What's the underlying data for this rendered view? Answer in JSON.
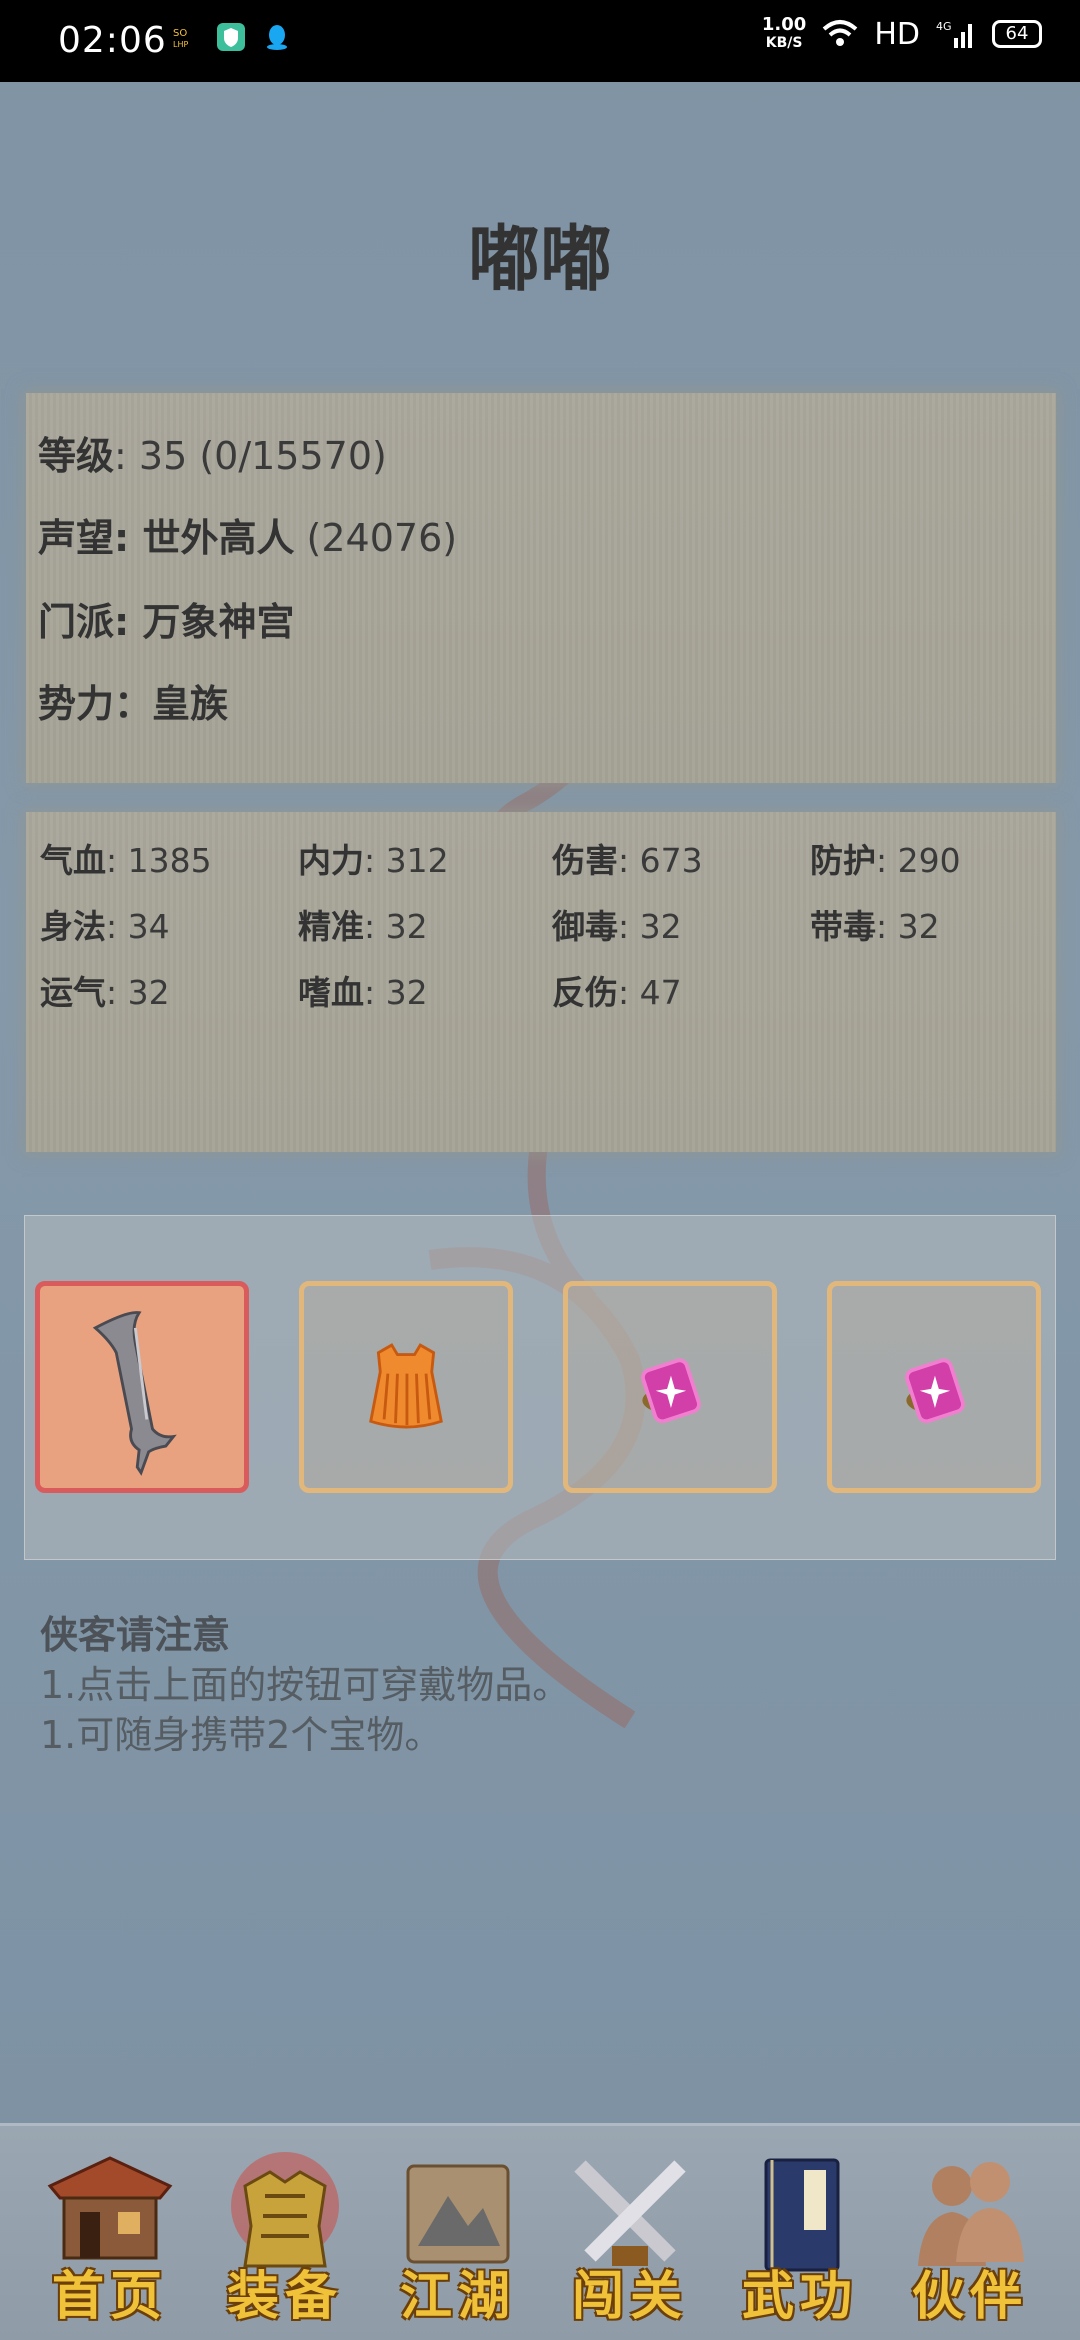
{
  "status_bar": {
    "time": "02:06",
    "speed_top": "1.00",
    "speed_bottom": "KB/S",
    "hd": "HD",
    "network": "4G",
    "battery": "64"
  },
  "character": {
    "name": "嘟嘟"
  },
  "info": {
    "level_label": "等级",
    "level_value": ": 35 (0/15570)",
    "fame_label": "声望",
    "fame_title": ": 世外高人",
    "fame_value": " (24076)",
    "sect_label": "门派",
    "sect_value": ": 万象神宫",
    "faction_label": "势力",
    "faction_value": "：皇族"
  },
  "stats": [
    {
      "label": "气血",
      "value": ": 1385"
    },
    {
      "label": "内力",
      "value": ": 312"
    },
    {
      "label": "伤害",
      "value": ": 673"
    },
    {
      "label": "防护",
      "value": ": 290"
    },
    {
      "label": "身法",
      "value": ": 34"
    },
    {
      "label": "精准",
      "value": ": 32"
    },
    {
      "label": "御毒",
      "value": ": 32"
    },
    {
      "label": "带毒",
      "value": ": 32"
    },
    {
      "label": "运气",
      "value": ": 32"
    },
    {
      "label": "嗜血",
      "value": ": 32"
    },
    {
      "label": "反伤",
      "value": ": 47"
    }
  ],
  "equipment": [
    {
      "icon": "sword-icon"
    },
    {
      "icon": "armor-icon"
    },
    {
      "icon": "gem-icon"
    },
    {
      "icon": "gem-icon"
    }
  ],
  "notice": {
    "title": "侠客请注意",
    "line1": "1.点击上面的按钮可穿戴物品。",
    "line2": "1.可随身携带2个宝物。"
  },
  "nav": [
    {
      "label": "首页",
      "icon": "house-icon"
    },
    {
      "label": "装备",
      "icon": "armor-icon"
    },
    {
      "label": "江湖",
      "icon": "scroll-map-icon"
    },
    {
      "label": "闯关",
      "icon": "crossed-swords-icon"
    },
    {
      "label": "武功",
      "icon": "book-icon"
    },
    {
      "label": "伙伴",
      "icon": "partners-icon"
    }
  ],
  "colors": {
    "background": "#8197a8",
    "parchment": "#a8a59a",
    "slot_border": "#e2b77c",
    "slot_active_border": "#d95b5b",
    "nav_label": "#f0c23a"
  }
}
